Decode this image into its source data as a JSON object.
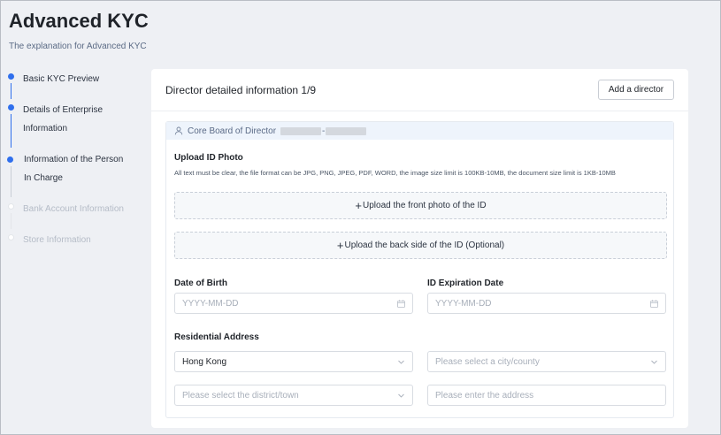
{
  "page": {
    "title": "Advanced KYC",
    "subtitle": "The explanation for Advanced KYC"
  },
  "steps": [
    {
      "label": "Basic KYC Preview",
      "state": "done"
    },
    {
      "label": "Details of Enterprise Information",
      "state": "done"
    },
    {
      "label": "Information of the Person In Charge",
      "state": "current"
    },
    {
      "label": "Bank Account Information",
      "state": "pending"
    },
    {
      "label": "Store Information",
      "state": "pending"
    }
  ],
  "card": {
    "title": "Director detailed information 1/9",
    "add_button": "Add a director"
  },
  "director": {
    "section_title": "Core Board of Director",
    "separator": "-"
  },
  "upload": {
    "label": "Upload ID Photo",
    "hint": "All text must be clear, the file format can be JPG, PNG, JPEG, PDF, WORD, the image size limit is 100KB-10MB, the document size limit is 1KB-10MB",
    "front_label": "Upload the front photo of the ID",
    "back_label": "Upload the back side of the ID (Optional)",
    "plus": "+"
  },
  "dob": {
    "label": "Date of Birth",
    "placeholder": "YYYY-MM-DD"
  },
  "expiry": {
    "label": "ID Expiration Date",
    "placeholder": "YYYY-MM-DD"
  },
  "address": {
    "label": "Residential Address",
    "country_value": "Hong Kong",
    "city_placeholder": "Please select a city/county",
    "district_placeholder": "Please select the district/town",
    "street_placeholder": "Please enter the address"
  },
  "colors": {
    "accent": "#2f6fed",
    "background": "#eef0f4",
    "panel_header": "#eef4fc"
  }
}
